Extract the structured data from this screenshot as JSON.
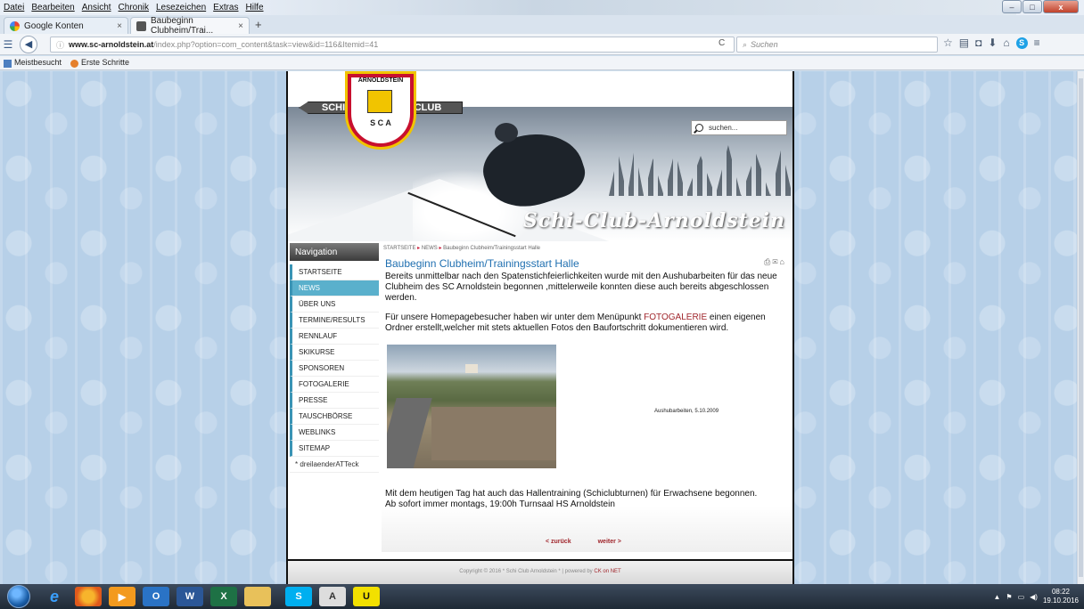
{
  "browser": {
    "menu": [
      "Datei",
      "Bearbeiten",
      "Ansicht",
      "Chronik",
      "Lesezeichen",
      "Extras",
      "Hilfe"
    ],
    "tabs": [
      {
        "label": "Google Konten",
        "close": "×"
      },
      {
        "label": "Baubeginn Clubheim/Trai...",
        "close": "×"
      }
    ],
    "new_tab": "+",
    "url_host": "www.sc-arnoldstein.at",
    "url_path": "/index.php?option=com_content&task=view&id=116&Itemid=41",
    "search_placeholder": "Suchen",
    "reload": "C",
    "bookmarks": [
      "Meistbesucht",
      "Erste Schritte"
    ],
    "window_controls": {
      "minimize": "–",
      "maximize": "□",
      "close": "x"
    }
  },
  "site": {
    "logo": {
      "left": "SCHI",
      "right": "CLUB",
      "top": "ARNOLDSTEIN",
      "bottom": "S C A"
    },
    "banner_title": "Schi-Club-Arnoldstein",
    "search_placeholder": "suchen...",
    "nav_heading": "Navigation",
    "nav_items": [
      "STARTSEITE",
      "NEWS",
      "ÜBER UNS",
      "TERMINE/RESULTS",
      "RENNLAUF",
      "SKIKURSE",
      "SPONSOREN",
      "FOTOGALERIE",
      "PRESSE",
      "TAUSCHBÖRSE",
      "WEBLINKS",
      "SITEMAP",
      "* dreilaenderATTeck"
    ],
    "active_nav": "NEWS",
    "breadcrumb": [
      "STARTSEITE",
      "NEWS",
      "Baubeginn Clubheim/Trainingsstart Halle"
    ],
    "breadcrumb_sep": "▸",
    "article": {
      "title": "Baubeginn Clubheim/Trainingsstart Halle",
      "icons": "⎙✉⌂",
      "p1": "Bereits unmittelbar nach den Spatenstichfeierlichkeiten wurde mit den Aushubarbeiten für das neue Clubheim des SC Arnoldstein begonnen ,mittelerweile konnten diese auch bereits abgeschlossen werden.",
      "p2_before": "Für unsere Homepagebesucher haben wir unter dem Menüpunkt ",
      "p2_link": "FOTOGALERIE",
      "p2_after": " einen eigenen Ordner erstellt,welcher mit stets aktuellen Fotos den Baufortschritt dokumentieren wird.",
      "caption": "Aushubarbeiten, 5.10.2009",
      "p3_line1": "Mit dem heutigen Tag hat auch das Hallentraining (Schiclubturnen) für Erwachsene begonnen.",
      "p3_line2": "Ab sofort immer montags, 19:00h Turnsaal HS Arnoldstein"
    },
    "pagenav": {
      "prev": "< zurück",
      "next": "weiter >"
    },
    "footer": {
      "text": "Copyright © 2016 * Schi Club Arnoldstein * | powered by ",
      "link": "CK on NET"
    }
  },
  "taskbar": {
    "apps": [
      "ie",
      "firefox",
      "media",
      "outlook",
      "word",
      "excel",
      "explorer",
      "skype",
      "acrobat",
      "ultraedit"
    ],
    "time": "08:22",
    "date": "19.10.2016"
  }
}
